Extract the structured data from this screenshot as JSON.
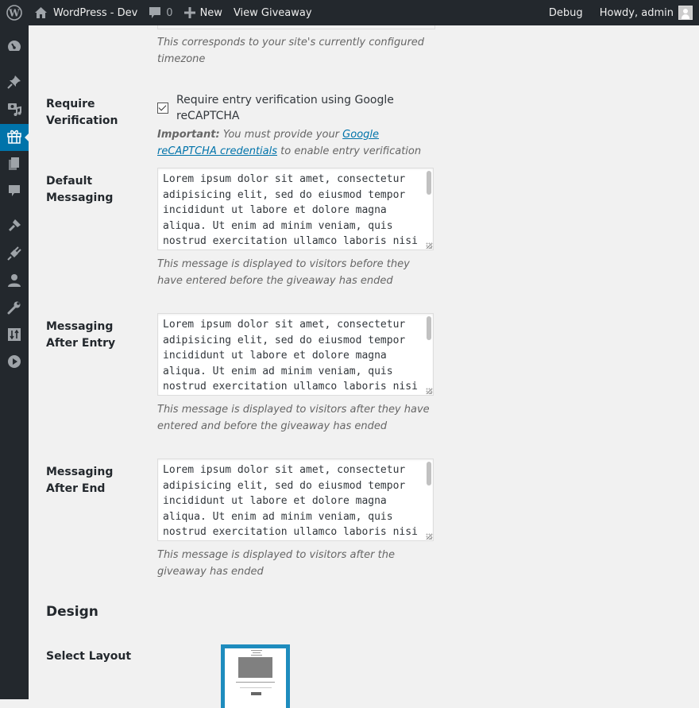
{
  "adminbar": {
    "site_name": "WordPress - Dev",
    "comments_count": "0",
    "new_label": "New",
    "view_label": "View Giveaway",
    "debug_label": "Debug",
    "howdy_label": "Howdy, admin"
  },
  "sidebar": {
    "items": [
      {
        "icon": "dashboard-icon"
      },
      {
        "icon": "pin-icon"
      },
      {
        "icon": "media-icon"
      },
      {
        "icon": "gift-icon",
        "active": true
      },
      {
        "icon": "pages-icon"
      },
      {
        "icon": "comments-icon"
      },
      {
        "icon": "appearance-icon"
      },
      {
        "icon": "plugins-icon"
      },
      {
        "icon": "users-icon"
      },
      {
        "icon": "tools-icon"
      },
      {
        "icon": "settings-icon"
      },
      {
        "icon": "video-icon"
      }
    ],
    "accent_color": "#0073aa"
  },
  "form": {
    "timezone_desc": "This corresponds to your site's currently configured timezone",
    "require_verification": {
      "label": "Require Verification",
      "checkbox_label": "Require entry verification using Google reCAPTCHA",
      "checked": true,
      "important_label": "Important:",
      "note_before": " You must provide your ",
      "link_text": "Google reCAPTCHA credentials",
      "note_after": " to enable entry verification"
    },
    "default_messaging": {
      "label": "Default Messaging",
      "value": "Lorem ipsum dolor sit amet, consectetur adipisicing elit, sed do eiusmod tempor incididunt ut labore et dolore magna aliqua. Ut enim ad minim veniam, quis nostrud exercitation ullamco laboris nisi ut aliquip ex ea commodo consequat.",
      "desc": "This message is displayed to visitors before they have entered before the giveaway has ended"
    },
    "messaging_after_entry": {
      "label": "Messaging After Entry",
      "value": "Lorem ipsum dolor sit amet, consectetur adipisicing elit, sed do eiusmod tempor incididunt ut labore et dolore magna aliqua. Ut enim ad minim veniam, quis nostrud exercitation ullamco laboris nisi ut aliquip ex ea commodo consequat.",
      "desc": "This message is displayed to visitors after they have entered and before the giveaway has ended"
    },
    "messaging_after_end": {
      "label": "Messaging After End",
      "value": "Lorem ipsum dolor sit amet, consectetur adipisicing elit, sed do eiusmod tempor incididunt ut labore et dolore magna aliqua. Ut enim ad minim veniam, quis nostrud exercitation ullamco laboris nisi ut aliquip ex ea commodo consequat.",
      "desc": "This message is displayed to visitors after the giveaway has ended"
    },
    "design": {
      "section_title": "Design",
      "select_layout_label": "Select Layout"
    }
  }
}
